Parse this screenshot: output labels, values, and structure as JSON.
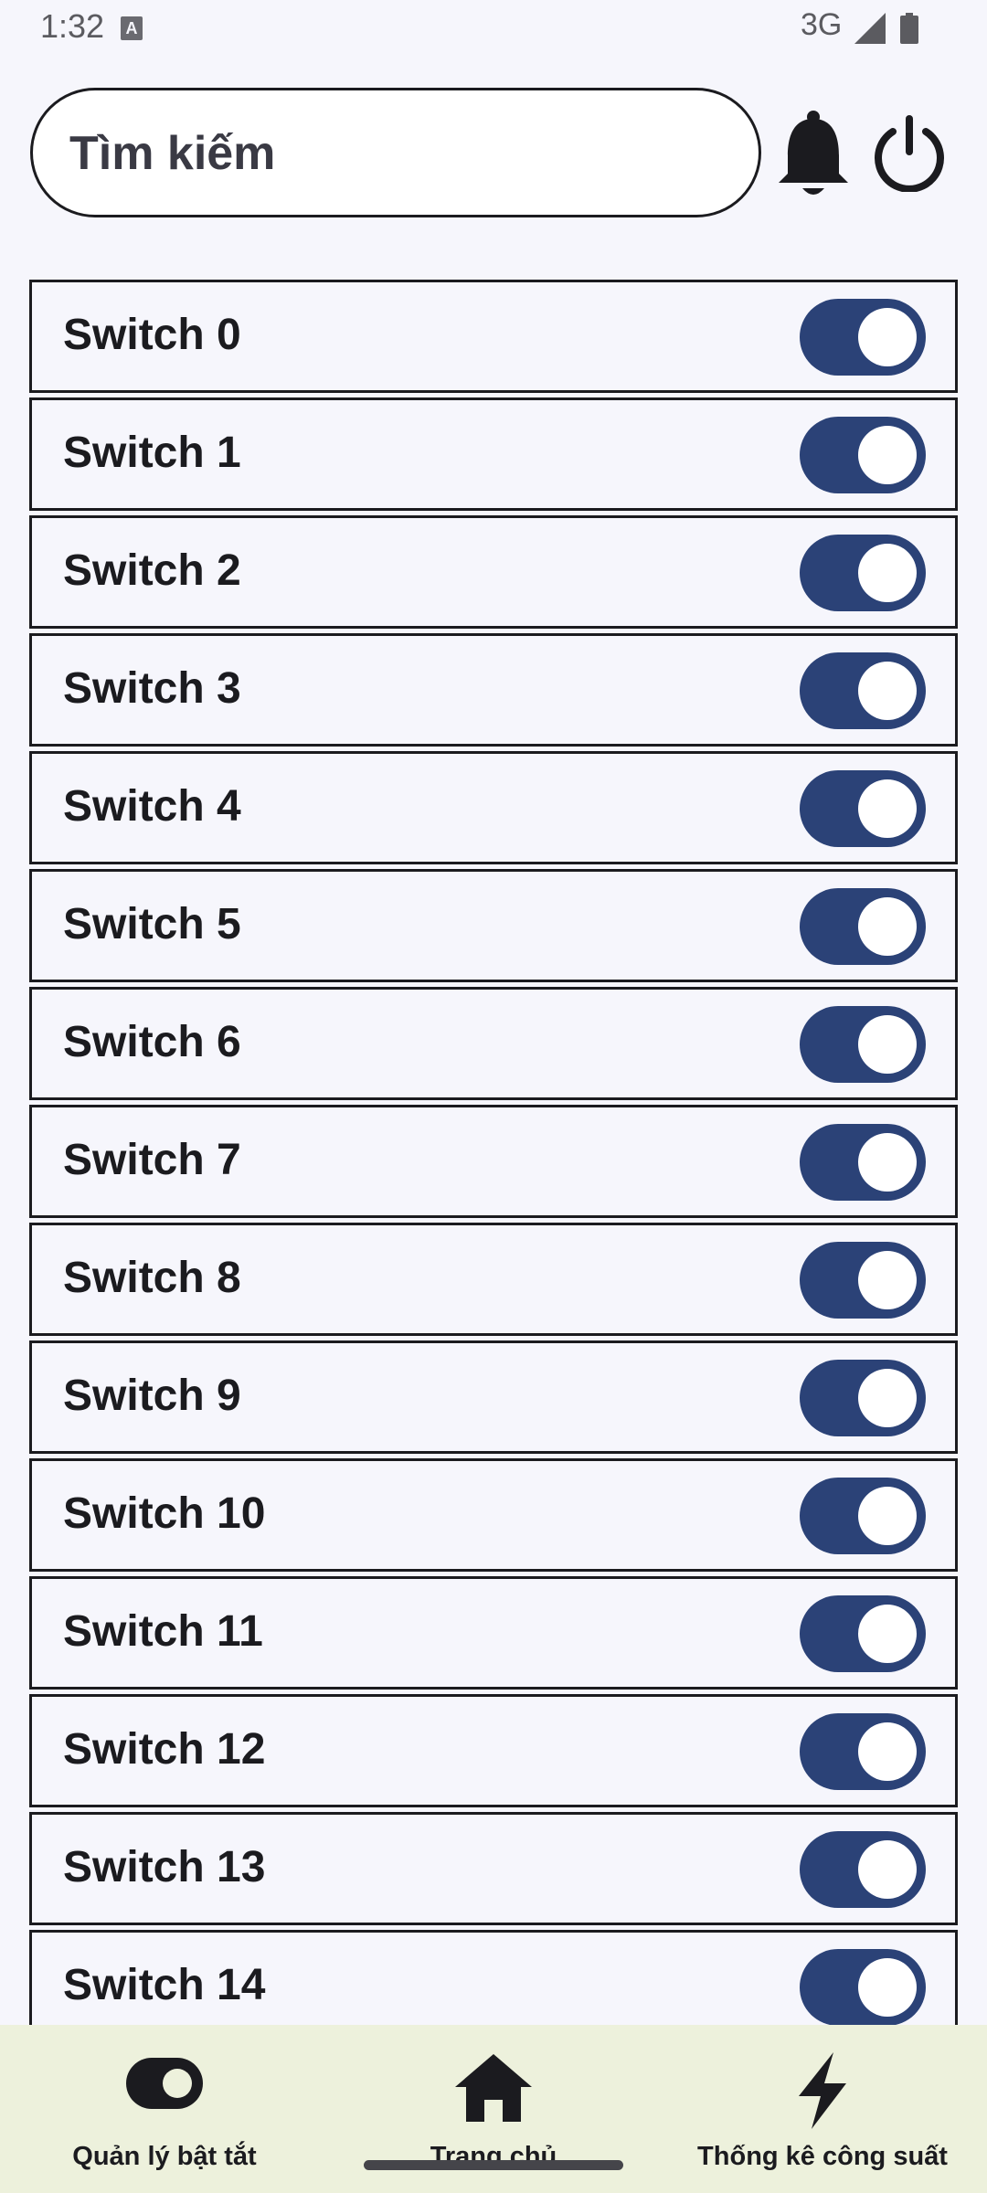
{
  "status_bar": {
    "time": "1:32",
    "notification_glyph": "A",
    "network": "3G",
    "icons": [
      "signal-icon",
      "battery-icon"
    ]
  },
  "header": {
    "search_placeholder": "Tìm kiếm",
    "icons": [
      "bell-icon",
      "power-icon"
    ]
  },
  "switches": [
    {
      "label": "Switch 0",
      "on": true
    },
    {
      "label": "Switch 1",
      "on": true
    },
    {
      "label": "Switch 2",
      "on": true
    },
    {
      "label": "Switch 3",
      "on": true
    },
    {
      "label": "Switch 4",
      "on": true
    },
    {
      "label": "Switch 5",
      "on": true
    },
    {
      "label": "Switch 6",
      "on": true
    },
    {
      "label": "Switch 7",
      "on": true
    },
    {
      "label": "Switch 8",
      "on": true
    },
    {
      "label": "Switch 9",
      "on": true
    },
    {
      "label": "Switch 10",
      "on": true
    },
    {
      "label": "Switch 11",
      "on": true
    },
    {
      "label": "Switch 12",
      "on": true
    },
    {
      "label": "Switch 13",
      "on": true
    },
    {
      "label": "Switch 14",
      "on": true
    }
  ],
  "bottom_nav": {
    "items": [
      {
        "label": "Quản lý bật tắt",
        "icon": "toggle-icon"
      },
      {
        "label": "Trang chủ",
        "icon": "home-icon"
      },
      {
        "label": "Thống kê công suất",
        "icon": "lightning-icon"
      }
    ]
  },
  "colors": {
    "background": "#f6f6fc",
    "toggle_on": "#2b4277",
    "bottom_nav_bg": "#edf1dc",
    "border": "#1b1b1f"
  }
}
